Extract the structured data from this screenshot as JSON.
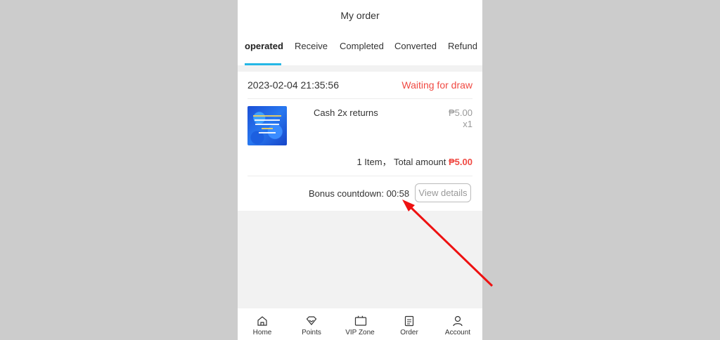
{
  "header": {
    "title": "My order"
  },
  "tabs": [
    {
      "label": "operated",
      "active": true
    },
    {
      "label": "Receive"
    },
    {
      "label": "Completed"
    },
    {
      "label": "Converted"
    },
    {
      "label": "Refund"
    }
  ],
  "order": {
    "date": "2023-02-04 21:35:56",
    "status": "Waiting for draw",
    "product": {
      "name": "Cash 2x returns",
      "price": "₱5.00",
      "qty": "x1"
    },
    "total_prefix": "1 Item， Total amount ",
    "total_amount": "₱5.00",
    "countdown": "Bonus countdown: 00:58",
    "view_details": "View details"
  },
  "bottom_nav": [
    {
      "label": "Home",
      "icon": "home-icon"
    },
    {
      "label": "Points",
      "icon": "diamond-icon"
    },
    {
      "label": "VIP Zone",
      "icon": "vip-icon"
    },
    {
      "label": "Order",
      "icon": "document-icon"
    },
    {
      "label": "Account",
      "icon": "user-icon"
    }
  ],
  "colors": {
    "accent": "#25b7e6",
    "status_red": "#f04a43",
    "background": "#cccccc",
    "arrow": "#ee1111"
  }
}
